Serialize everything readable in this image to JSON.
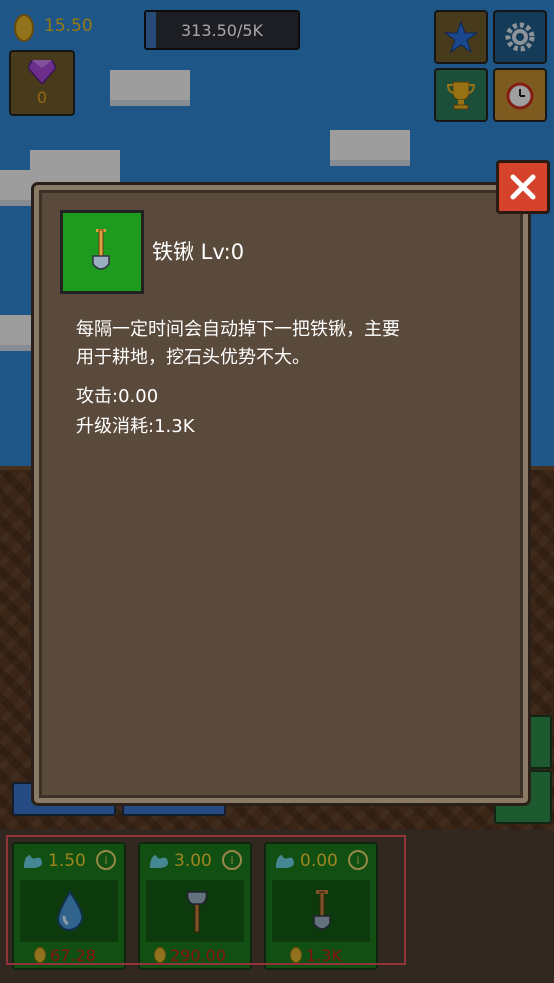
{
  "top_bar": {
    "coins": "15.50",
    "gems": "0",
    "progress_text": "313.50/5K",
    "progress_fraction": 0.063
  },
  "modal": {
    "title": "铁锹 Lv:0",
    "description": "每隔一定时间会自动掉下一把铁锹，主要\n用于耕地，挖石头优势不大。",
    "attack": "攻击:0.00",
    "upgrade_cost": "升级消耗:1.3K"
  },
  "cards": [
    {
      "value": "1.50",
      "price": "67.28",
      "item_icon": "water-drop-icon"
    },
    {
      "value": "3.00",
      "price": "290.00",
      "item_icon": "axe-icon"
    },
    {
      "value": "0.00",
      "price": "1.3K",
      "item_icon": "shovel-icon"
    }
  ],
  "colors": {
    "sky": "#2f86d0",
    "modal_bg": "#5a4a3c",
    "close_red": "#d6432c",
    "card_green": "#1c7a1c",
    "price_red": "#d01818",
    "gold": "#e8b820"
  }
}
